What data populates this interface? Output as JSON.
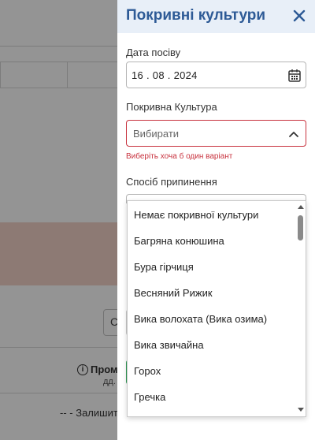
{
  "background": {
    "info_icon_glyph": "i",
    "search_glyph": "C",
    "col_header": "Пром",
    "col_subheader": "дд.",
    "row_text": "-- - Залишит"
  },
  "panel": {
    "title": "Покривні культури",
    "close_icon": "close-icon"
  },
  "sowing_date": {
    "label": "Дата посіву",
    "value": "16 . 08 . 2024",
    "icon": "calendar-icon"
  },
  "cover_crop": {
    "label": "Покривна Культура",
    "placeholder": "Вибирати",
    "error": "Виберіть хоча б один варіант",
    "border_color": "#c8323e",
    "options": [
      "Немає покривної культури",
      "Багряна конюшина",
      "Бура гірчиця",
      "Весняний Рижик",
      "Вика волохата (Вика озима)",
      "Вика звичайна",
      "Горох",
      "Гречка"
    ]
  },
  "termination": {
    "label": "Спосіб припинення"
  },
  "colors": {
    "title": "#2d5a96",
    "header_bg": "#e8eff8",
    "error": "#c8323e"
  }
}
